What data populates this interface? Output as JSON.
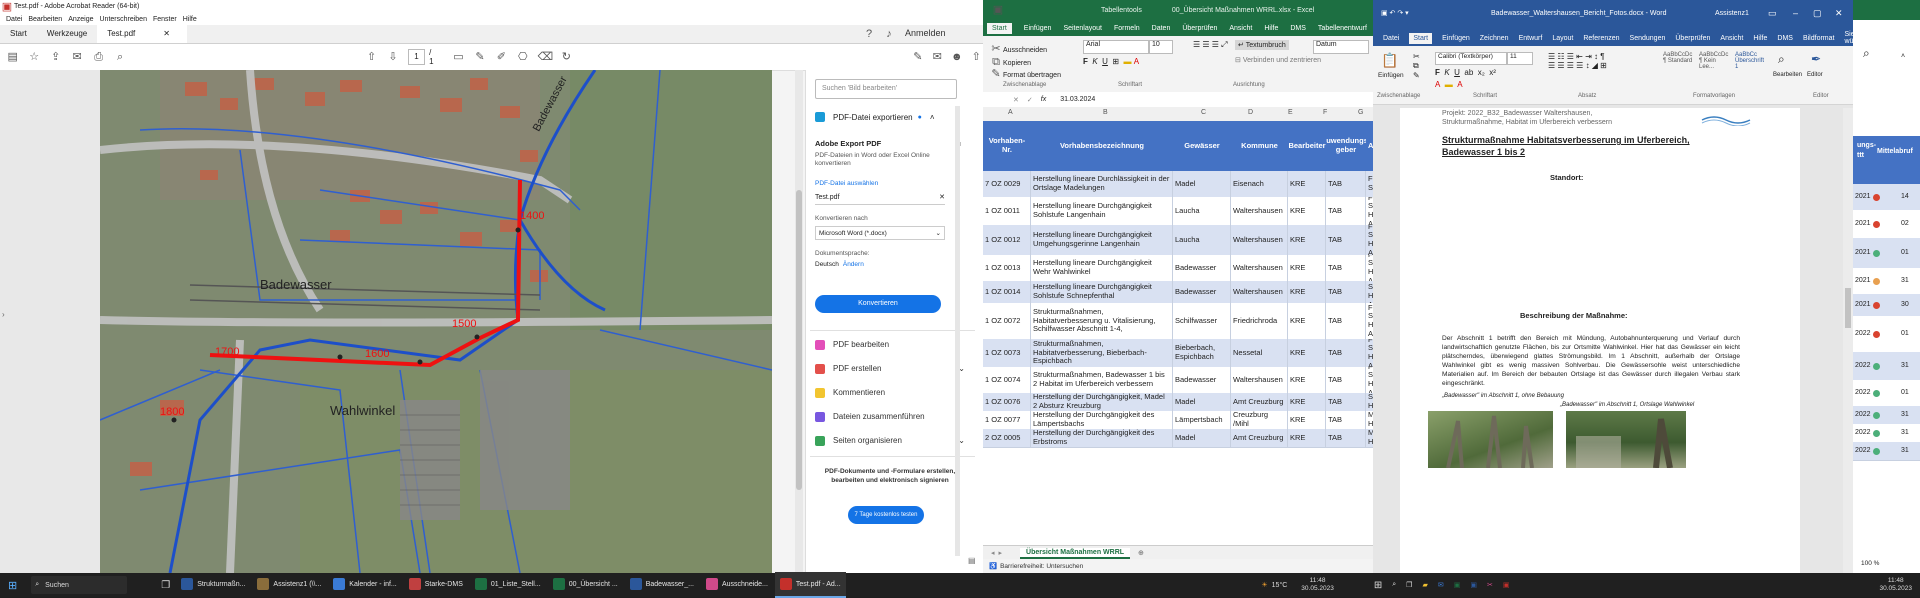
{
  "acrobat": {
    "title": "Test.pdf - Adobe Acrobat Reader (64-bit)",
    "menu": [
      "Datei",
      "Bearbeiten",
      "Anzeige",
      "Unterschreiben",
      "Fenster",
      "Hilfe"
    ],
    "header_right": "Anmelden",
    "tabs": [
      "Start",
      "Werkzeuge",
      "Test.pdf"
    ],
    "page_input": "1",
    "page_total": "/ 1",
    "map_labels": {
      "badewasser_top": "Badewasser",
      "badewasser_mid": "Badewasser",
      "wahlwinkel": "Wahlwinkel",
      "m1400": "1400",
      "m1500": "1500",
      "m1600": "1600",
      "m1700": "1700",
      "m1800": "1800"
    },
    "panel": {
      "search_placeholder": "Suchen 'Bild bearbeiten'",
      "export_title": "PDF-Datei exportieren",
      "export_subtitle": "Adobe Export PDF",
      "export_desc": "PDF-Dateien in Word oder Excel Online konvertieren",
      "select_label": "PDF-Datei auswählen",
      "file_name": "Test.pdf",
      "convert_to_label": "Konvertieren nach",
      "convert_to_value": "Microsoft Word (*.docx)",
      "doc_lang_label": "Dokumentsprache:",
      "doc_lang_value": "Deutsch",
      "change_link": "Ändern",
      "convert_button": "Konvertieren",
      "tools": [
        "PDF bearbeiten",
        "PDF erstellen",
        "Kommentieren",
        "Dateien zusammenführen",
        "Seiten organisieren"
      ],
      "promo_text": "PDF-Dokumente und -Formulare erstellen, bearbeiten und elektronisch signieren",
      "trial_button": "7 Tage kostenlos testen"
    }
  },
  "excel": {
    "title": "00_Übersicht Maßnahmen WRRL.xlsx - Excel",
    "context_tab": "Tabellentools",
    "ribbon_tabs": [
      "Start",
      "Einfügen",
      "Seitenlayout",
      "Formeln",
      "Daten",
      "Überprüfen",
      "Ansicht",
      "Hilfe",
      "DMS",
      "Tabellenentwurf"
    ],
    "clipboard": {
      "cut": "Ausschneiden",
      "copy": "Kopieren",
      "format_painter": "Format übertragen",
      "group": "Zwischenablage"
    },
    "font_name": "Arial",
    "font_size": "10",
    "font_group": "Schriftart",
    "wrap": "Textumbruch",
    "merge": "Verbinden und zentrieren",
    "align_group": "Ausrichtung",
    "number_format": "Datum",
    "formula_value": "31.03.2024",
    "col_letters": [
      "A",
      "B",
      "C",
      "D",
      "E",
      "F",
      "G"
    ],
    "headers": [
      "Vorhaben-Nr.",
      "Vorhabensbezeichnung",
      "Gewässer",
      "Kommune",
      "Bearbeiter",
      "Zuwendungs-geber",
      "An"
    ],
    "rows": [
      {
        "nr": "7 OZ 0029",
        "name": "Herstellung lineare Durchlässigkeit in der Ortslage Madelungen",
        "gew": "Madel",
        "kom": "Eisenach",
        "bea": "KRE",
        "zuw": "TAB",
        "an": "Fr. S"
      },
      {
        "nr": "1 OZ 0011",
        "name": "Herstellung lineare Durchgängigkeit Sohlstufe Langenhain",
        "gew": "Laucha",
        "kom": "Waltershausen",
        "bea": "KRE",
        "zuw": "TAB",
        "an": "Fr. S Hr. A"
      },
      {
        "nr": "1 OZ 0012",
        "name": "Herstellung lineare Durchgängigkeit Umgehungsgerinne Langenhain",
        "gew": "Laucha",
        "kom": "Waltershausen",
        "bea": "KRE",
        "zuw": "TAB",
        "an": "Fr. S Hr. A"
      },
      {
        "nr": "1 OZ 0013",
        "name": "Herstellung lineare Durchgängigkeit Wehr Wahlwinkel",
        "gew": "Badewasser",
        "kom": "Waltershausen",
        "bea": "KRE",
        "zuw": "TAB",
        "an": "Fr. S Hr. A"
      },
      {
        "nr": "1 OZ 0014",
        "name": "Herstellung lineare Durchgängigkeit Sohlstufe Schnepfenthal",
        "gew": "Badewasser",
        "kom": "Waltershausen",
        "bea": "KRE",
        "zuw": "TAB",
        "an": "Fr. S Hr. A"
      },
      {
        "nr": "1 OZ 0072",
        "name": "Strukturmaßnahmen, Habitatverbesserung u. Vitalisierung, Schilfwasser Abschnitt 1-4,",
        "gew": "Schilfwasser",
        "kom": "Friedrichroda",
        "bea": "KRE",
        "zuw": "TAB",
        "an": "Fr. S Hr. A"
      },
      {
        "nr": "1 OZ 0073",
        "name": "Strukturmaßnahmen, Habitatverbesserung, Bieberbach-Espichbach",
        "gew": "Bieberbach, Espichbach",
        "kom": "Nessetal",
        "bea": "KRE",
        "zuw": "TAB",
        "an": "Fr. S Hr. A"
      },
      {
        "nr": "1 OZ 0074",
        "name": "Strukturmaßnahmen, Badewasser 1 bis 2 Habitat im Uferbereich verbessern",
        "gew": "Badewasser",
        "kom": "Waltershausen",
        "bea": "KRE",
        "zuw": "TAB",
        "an": "Fr. S Hr. A"
      },
      {
        "nr": "1 OZ 0076",
        "name": "Herstellung der Durchgängigkeit, Madel 2 Absturz Kreuzburg",
        "gew": "Madel",
        "kom": "Amt Creuzburg",
        "bea": "KRE",
        "zuw": "TAB",
        "an": "Fr. S Hr. A"
      },
      {
        "nr": "1 OZ 0077",
        "name": "Herstellung der Durchgängigkeit des Lämpertsbachs",
        "gew": "Lämpertsbach",
        "kom": "Creuzburg /Mihl",
        "bea": "KRE",
        "zuw": "TAB",
        "an": "Fr. M Hr. A"
      },
      {
        "nr": "2 OZ 0005",
        "name": "Herstellung der Durchgängigkeit des Erbstroms",
        "gew": "Madel",
        "kom": "Amt Creuzburg",
        "bea": "KRE",
        "zuw": "TAB",
        "an": "Fr. M Hr. A"
      }
    ],
    "sheet_tab": "Übersicht Maßnahmen WRRL",
    "status": "Barrierefreiheit: Untersuchen"
  },
  "word": {
    "title": "Badewasser_Waltershausen_Bericht_Fotos.docx - Word",
    "user": "Assistenz1",
    "ribbon_tabs": [
      "Datei",
      "Start",
      "Einfügen",
      "Zeichnen",
      "Entwurf",
      "Layout",
      "Referenzen",
      "Sendungen",
      "Überprüfen",
      "Ansicht",
      "Hilfe",
      "DMS",
      "Bildformat",
      "Sie wüns"
    ],
    "font_name": "Calibri (Textkörper)",
    "font_size": "11",
    "groups": [
      "Zwischenablage",
      "Schriftart",
      "Absatz",
      "Formatvorlagen",
      "Editor"
    ],
    "styles": [
      "AaBbCcDc",
      "AaBbCcDc",
      "AaBbCc"
    ],
    "style_names": [
      "¶ Standard",
      "¶ Kein Lee...",
      "Überschrift 1"
    ],
    "paste": "Einfügen",
    "edit": "Bearbeiten",
    "editor": "Editor",
    "header_line1": "Projekt: 2022_B32_Badewasser Waltershausen,",
    "header_line2": "Strukturmaßnahme, Habitat im Uferbereich verbessern",
    "doc_title": "Strukturmaßnahme Habitatsverbesserung im Uferbereich, Badewasser 1 bis 2",
    "standort": "Standort:",
    "beschreibung_title": "Beschreibung der Maßnahme:",
    "beschreibung": "Der Abschnitt 1 betrifft den Bereich mit Mündung, Autobahnunterquerung und Verlauf durch landwirtschaftlich genutzte Flächen, bis zur Ortsmitte Wahlwinkel. Hier hat das Gewässer ein leicht plätscherndes, überwiegend glattes Strömungsbild. Im 1 Abschnitt, außerhalb der Ortslage Wahlwinkel gibt es wenig massiven Sohlverbau. Die Gewässersohle weist unterschiedliche Materialien auf. Im Bereich der bebauten Ortslage ist das Gewässer durch illegalen Verbau stark eingeschränkt.",
    "caption1": "„Badewasser\" im Abschnitt 1, ohne Bebauung",
    "caption2": "„Badewasser\" im Abschnitt 1, Ortslage Wahlwinkel"
  },
  "strip": {
    "header1": "ungs-",
    "header2": "ttt",
    "header3": "Mittelabruf",
    "rows": [
      "2021",
      "2021",
      "2021",
      "2021",
      "2021",
      "2022",
      "2022",
      "2022",
      "2022",
      "2022",
      "2022"
    ],
    "vals": [
      "14",
      "02",
      "01",
      "31",
      "30",
      "01",
      "31",
      "01",
      "31",
      "31",
      "31"
    ],
    "status_colors": [
      "#d9432f",
      "#d9432f",
      "#4caf7a",
      "#e8a050",
      "#d9432f",
      "#d9432f",
      "#4caf7a",
      "#4caf7a",
      "#4caf7a",
      "#4caf7a",
      "#4caf7a"
    ],
    "zoom": "100 %"
  },
  "taskbar": {
    "search": "Suchen",
    "apps": [
      "Strukturmaßn...",
      "Assistenz1 (\\\\...",
      "Kalender - inf...",
      "Starke-DMS",
      "01_Liste_Stell...",
      "00_Übersicht ...",
      "Badewasser_...",
      "Ausschneide...",
      "Test.pdf - Ad..."
    ],
    "app_colors": [
      "#2b579a",
      "#8a6d3b",
      "#3a7bd5",
      "#c04040",
      "#1d6f42",
      "#1d6f42",
      "#2b579a",
      "#d04a8a",
      "#c4302b"
    ],
    "weather": "15°C",
    "time1": "11:48",
    "date1": "30.05.2023",
    "time2": "11:48",
    "date2": "30.05.2023"
  }
}
